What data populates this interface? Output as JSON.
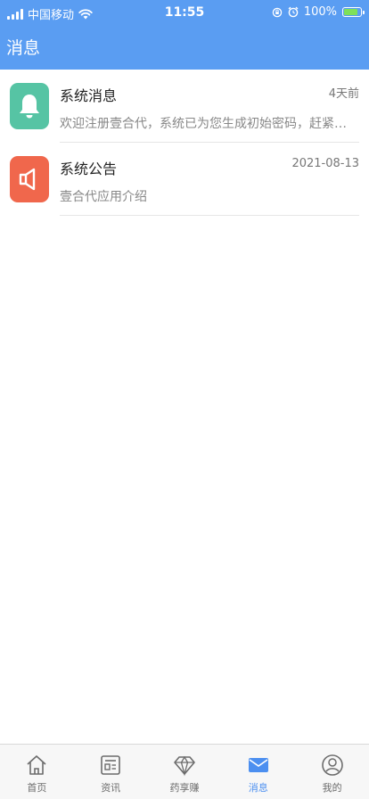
{
  "status_bar": {
    "carrier": "中国移动",
    "time": "11:55",
    "battery": "100%"
  },
  "header": {
    "title": "消息"
  },
  "messages": [
    {
      "title": "系统消息",
      "time": "4天前",
      "preview": "欢迎注册壹合代，系统已为您生成初始密码，赶紧查看...",
      "icon": "bell-icon",
      "color": "#56c4a4"
    },
    {
      "title": "系统公告",
      "time": "2021-08-13",
      "preview": "壹合代应用介绍",
      "icon": "speaker-icon",
      "color": "#f0674c"
    }
  ],
  "tabs": [
    {
      "label": "首页",
      "icon": "home-icon",
      "active": false
    },
    {
      "label": "资讯",
      "icon": "news-icon",
      "active": false
    },
    {
      "label": "药享赚",
      "icon": "diamond-icon",
      "active": false
    },
    {
      "label": "消息",
      "icon": "mail-icon",
      "active": true
    },
    {
      "label": "我的",
      "icon": "profile-icon",
      "active": false
    }
  ],
  "colors": {
    "header_bg": "#5a9df2",
    "tab_active": "#4c8ff0",
    "tab_inactive": "#6c6c6c"
  }
}
